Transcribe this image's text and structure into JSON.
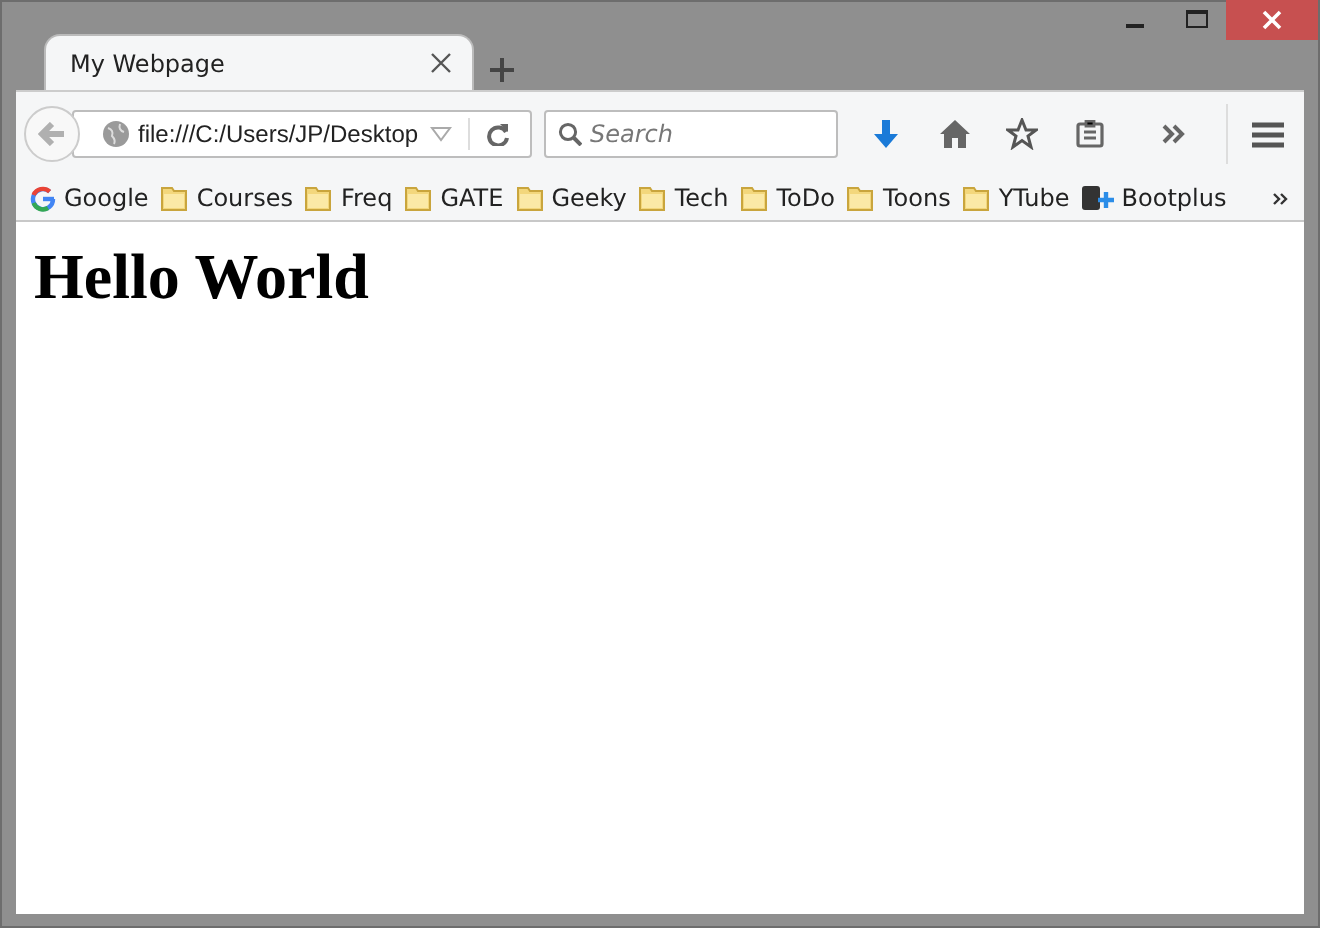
{
  "tab": {
    "title": "My Webpage",
    "selected": true
  },
  "address": {
    "value": "file:///C:/Users/JP/Desktop"
  },
  "search": {
    "placeholder": "Search"
  },
  "bookmarks": [
    {
      "label": "Google",
      "kind": "google"
    },
    {
      "label": "Courses",
      "kind": "folder"
    },
    {
      "label": "Freq",
      "kind": "folder"
    },
    {
      "label": "GATE",
      "kind": "folder"
    },
    {
      "label": "Geeky",
      "kind": "folder"
    },
    {
      "label": "Tech",
      "kind": "folder"
    },
    {
      "label": "ToDo",
      "kind": "folder"
    },
    {
      "label": "Toons",
      "kind": "folder"
    },
    {
      "label": "YTube",
      "kind": "folder"
    },
    {
      "label": "Bootplus",
      "kind": "bootplus"
    }
  ],
  "content": {
    "heading": "Hello World"
  }
}
